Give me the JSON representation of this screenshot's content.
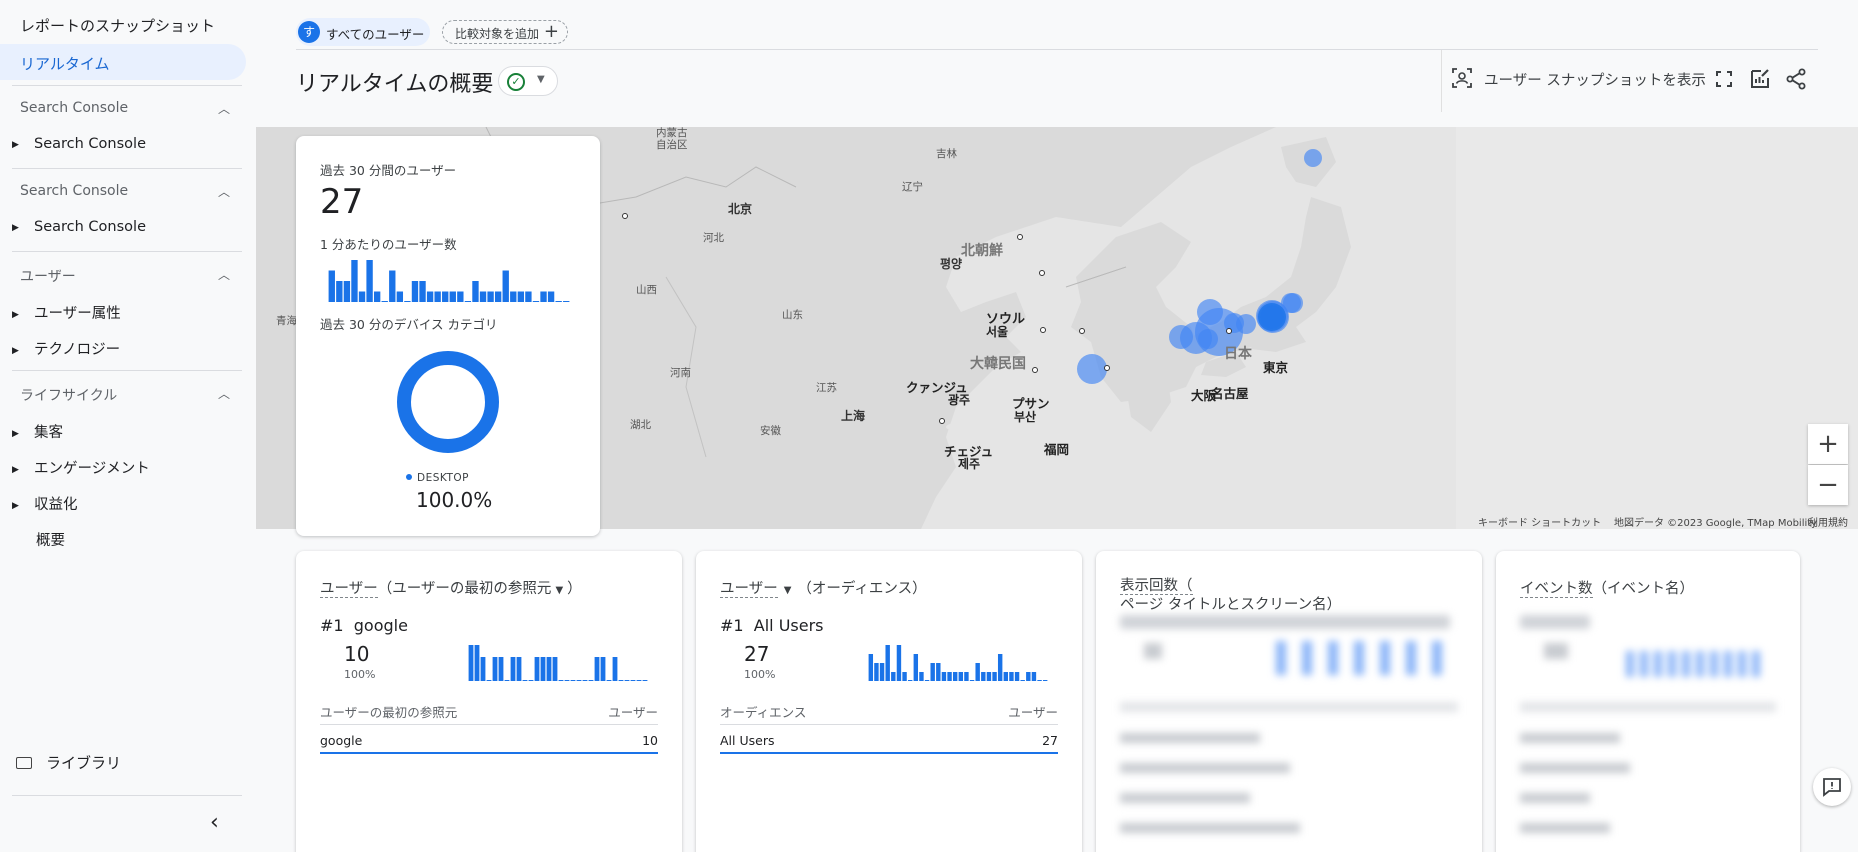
{
  "sidebar": {
    "snapshot": "レポートのスナップショット",
    "realtime": "リアルタイム",
    "sections": [
      {
        "title": "Search Console",
        "items": [
          "Search Console"
        ]
      },
      {
        "title": "Search Console",
        "items": [
          "Search Console"
        ]
      },
      {
        "title": "ユーザー",
        "items": [
          "ユーザー属性",
          "テクノロジー"
        ]
      },
      {
        "title": "ライフサイクル",
        "items": [
          "集客",
          "エンゲージメント",
          "収益化"
        ],
        "plain": "概要"
      }
    ],
    "library": "ライブラリ"
  },
  "header": {
    "chip_avatar": "す",
    "chip_all_users": "すべてのユーザー",
    "chip_add": "比較対象を追加",
    "title": "リアルタイムの概要",
    "snapshot_button": "ユーザー スナップショットを表示"
  },
  "map": {
    "labels": {
      "neimenggu": "内蒙古\n自治区",
      "jilin": "吉林",
      "liaoning": "辽宁",
      "beijing": "北京",
      "hebei": "河北",
      "shanxi": "山西",
      "shandong": "山东",
      "henan": "河南",
      "jiangsu": "江苏",
      "shanghai": "上海",
      "hubei": "湖北",
      "anhui": "安徽",
      "qinghai": "青海",
      "north_korea": "北朝鮮",
      "pyongyang": "평양",
      "seoul_ja": "ソウル",
      "seoul_ko": "서울",
      "south_korea": "大韓民国",
      "gwangju_ja": "クァンジュ",
      "gwangju_ko": "광주",
      "busan_ja": "プサン",
      "busan_ko": "부산",
      "jeju_ja": "チェジュ",
      "jeju_ko": "제주",
      "japan": "日本",
      "osaka": "大阪",
      "nagoya": "名古屋",
      "tokyo": "東京",
      "fukuoka": "福岡"
    },
    "zoom_in": "+",
    "zoom_out": "−",
    "footer": {
      "keyboard": "キーボード ショートカット",
      "mapdata": "地図データ ©2023 Google, TMap Mobility",
      "terms": "利用規約"
    },
    "colors": {
      "land": "#dadada",
      "water": "#e5e5e5",
      "bubble": "#4285f4"
    }
  },
  "realtime": {
    "users_label": "過去 30 分間のユーザー",
    "users_value": "27",
    "per_minute_label": "1 分あたりのユーザー数",
    "per_minute_bars": [
      3,
      2,
      2,
      4,
      1,
      4,
      1,
      0,
      3,
      1,
      0,
      2,
      2,
      1,
      1,
      1,
      1,
      1,
      0,
      2,
      1,
      1,
      1,
      3,
      1,
      1,
      1,
      0,
      1,
      1,
      0,
      0
    ],
    "device_label": "過去 30 分のデバイス カテゴリ",
    "device_legend": "DESKTOP",
    "device_pct": "100.0%",
    "device_fraction": 1.0
  },
  "cards": [
    {
      "title_a": "ユーザー",
      "title_b": "（ユーザーの最初の参照元",
      "title_c": "）",
      "rank": "#1",
      "rank_name": "google",
      "value": "10",
      "pct": "100%",
      "bars": [
        3,
        3,
        2,
        0,
        2,
        2,
        0,
        2,
        2,
        0,
        0,
        2,
        2,
        2,
        2,
        0,
        0,
        0,
        0,
        0,
        0,
        2,
        2,
        0,
        2,
        0,
        0,
        0,
        0,
        0
      ],
      "col_left": "ユーザーの最初の参照元",
      "col_right": "ユーザー",
      "row_left": "google",
      "row_right": "10"
    },
    {
      "title_a": "ユーザー",
      "title_b": "（オーディエンス）",
      "rank": "#1",
      "rank_name": "All Users",
      "value": "27",
      "pct": "100%",
      "bars": [
        3,
        2,
        2,
        4,
        1,
        4,
        1,
        0,
        3,
        1,
        0,
        2,
        2,
        1,
        1,
        1,
        1,
        1,
        0,
        2,
        1,
        1,
        1,
        3,
        1,
        1,
        1,
        0,
        1,
        1,
        0,
        0
      ],
      "col_left": "オーディエンス",
      "col_right": "ユーザー",
      "row_left": "All Users",
      "row_right": "27"
    },
    {
      "title_a": "表示回数（",
      "title_b": "ページ タイトルとスクリーン名）"
    },
    {
      "title_a": "イベント数",
      "title_b": "（イベント名）"
    }
  ]
}
